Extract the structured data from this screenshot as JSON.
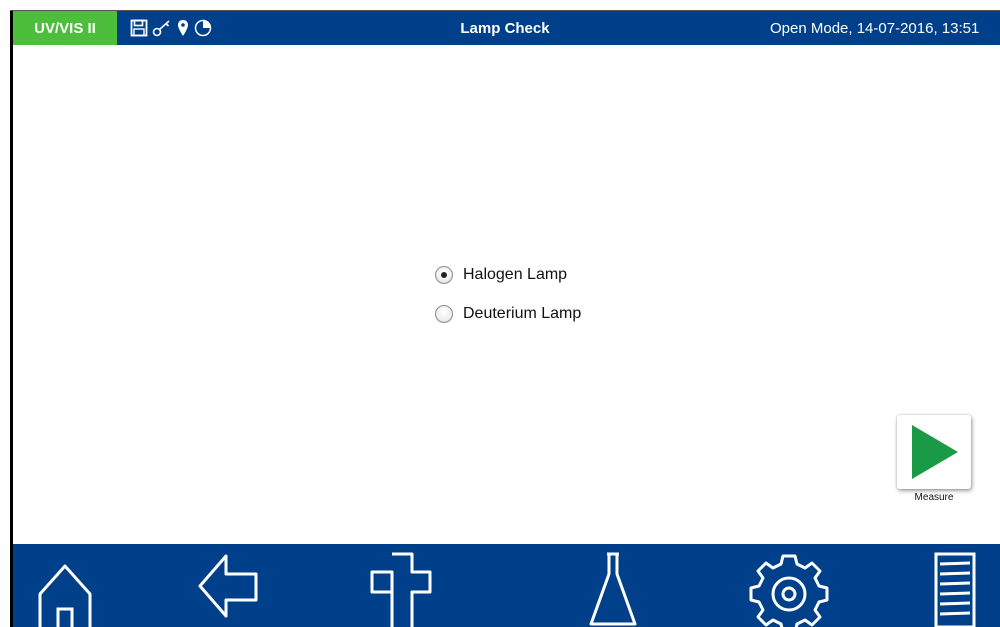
{
  "topbar": {
    "mode_badge": "UV/VIS II",
    "title": "Lamp Check",
    "status": "Open Mode, 14-07-2016, 13:51",
    "status_icons": [
      "save-icon",
      "key-icon",
      "location-pin-icon",
      "pie-chart-icon"
    ]
  },
  "options": [
    {
      "label": "Halogen Lamp",
      "selected": true
    },
    {
      "label": "Deuterium Lamp",
      "selected": false
    }
  ],
  "measure": {
    "label": "Measure",
    "icon": "play-icon"
  },
  "bottom_nav": [
    "home-icon",
    "back-arrow-icon",
    "add-icon",
    "flask-icon",
    "settings-gear-icon",
    "menu-list-icon"
  ],
  "colors": {
    "bar_blue": "#00408a",
    "mode_green": "#4cbe3c",
    "play_green": "#1a9a46"
  }
}
